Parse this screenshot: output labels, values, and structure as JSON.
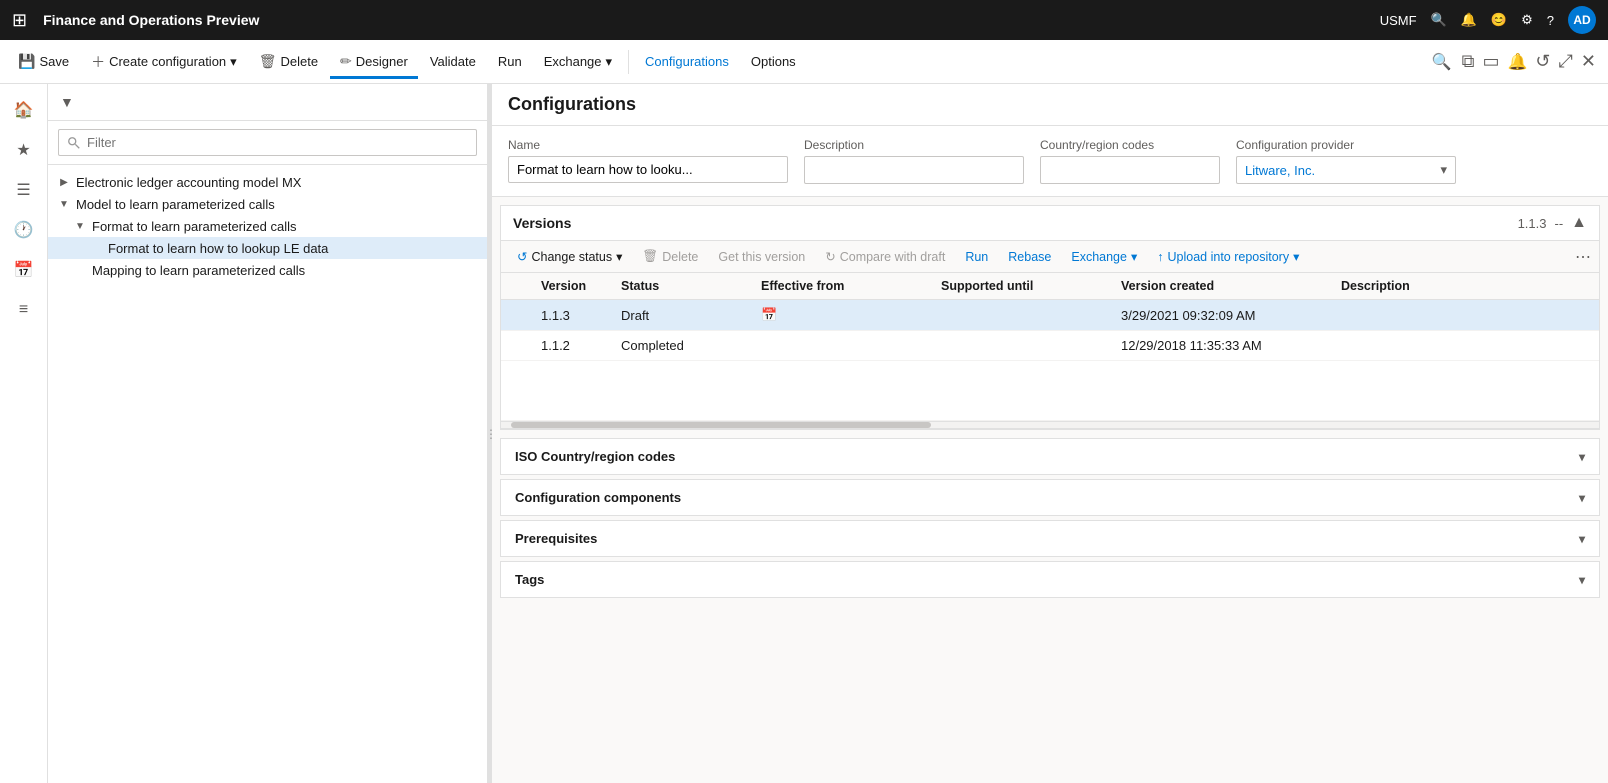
{
  "titleBar": {
    "appTitle": "Finance and Operations Preview",
    "userCode": "USMF",
    "avatarText": "AD"
  },
  "commandBar": {
    "saveLabel": "Save",
    "createConfigLabel": "Create configuration",
    "deleteLabel": "Delete",
    "designerLabel": "Designer",
    "validateLabel": "Validate",
    "runLabel": "Run",
    "exchangeLabel": "Exchange",
    "configurationsLabel": "Configurations",
    "optionsLabel": "Options"
  },
  "treePanel": {
    "filterPlaceholder": "Filter",
    "items": [
      {
        "level": 0,
        "toggle": "▶",
        "text": "Electronic ledger accounting model MX",
        "selected": false
      },
      {
        "level": 0,
        "toggle": "▼",
        "text": "Model to learn parameterized calls",
        "selected": false
      },
      {
        "level": 1,
        "toggle": "▼",
        "text": "Format to learn parameterized calls",
        "selected": false
      },
      {
        "level": 2,
        "toggle": "",
        "text": "Format to learn how to lookup LE data",
        "selected": true
      },
      {
        "level": 1,
        "toggle": "",
        "text": "Mapping to learn parameterized calls",
        "selected": false
      }
    ]
  },
  "mainContent": {
    "pageTitle": "Configurations",
    "form": {
      "nameLabel": "Name",
      "nameValue": "Format to learn how to looku...",
      "descriptionLabel": "Description",
      "descriptionValue": "",
      "countryRegionLabel": "Country/region codes",
      "countryRegionValue": "",
      "configProviderLabel": "Configuration provider",
      "configProviderValue": "Litware, Inc."
    },
    "versions": {
      "title": "Versions",
      "badge": "1.1.3",
      "badgeSeparator": "--",
      "toolbar": {
        "changeStatusLabel": "Change status",
        "deleteLabel": "Delete",
        "getThisVersionLabel": "Get this version",
        "compareWithDraftLabel": "Compare with draft",
        "runLabel": "Run",
        "rebaseLabel": "Rebase",
        "exchangeLabel": "Exchange",
        "uploadIntoRepositoryLabel": "Upload into repository"
      },
      "columns": [
        {
          "id": "checkbox",
          "label": ""
        },
        {
          "id": "version",
          "label": "Version"
        },
        {
          "id": "status",
          "label": "Status"
        },
        {
          "id": "effectiveFrom",
          "label": "Effective from"
        },
        {
          "id": "supportedUntil",
          "label": "Supported until"
        },
        {
          "id": "versionCreated",
          "label": "Version created"
        },
        {
          "id": "description",
          "label": "Description"
        }
      ],
      "rows": [
        {
          "selected": true,
          "version": "1.1.3",
          "status": "Draft",
          "effectiveFrom": "",
          "showCalendar": true,
          "supportedUntil": "",
          "versionCreated": "3/29/2021 09:32:09 AM",
          "description": ""
        },
        {
          "selected": false,
          "version": "1.1.2",
          "status": "Completed",
          "effectiveFrom": "",
          "showCalendar": false,
          "supportedUntil": "",
          "versionCreated": "12/29/2018 11:35:33 AM",
          "description": ""
        }
      ]
    },
    "accordions": [
      {
        "id": "iso-country",
        "label": "ISO Country/region codes",
        "expanded": false
      },
      {
        "id": "config-components",
        "label": "Configuration components",
        "expanded": false
      },
      {
        "id": "prerequisites",
        "label": "Prerequisites",
        "expanded": false
      },
      {
        "id": "tags",
        "label": "Tags",
        "expanded": false
      }
    ]
  }
}
